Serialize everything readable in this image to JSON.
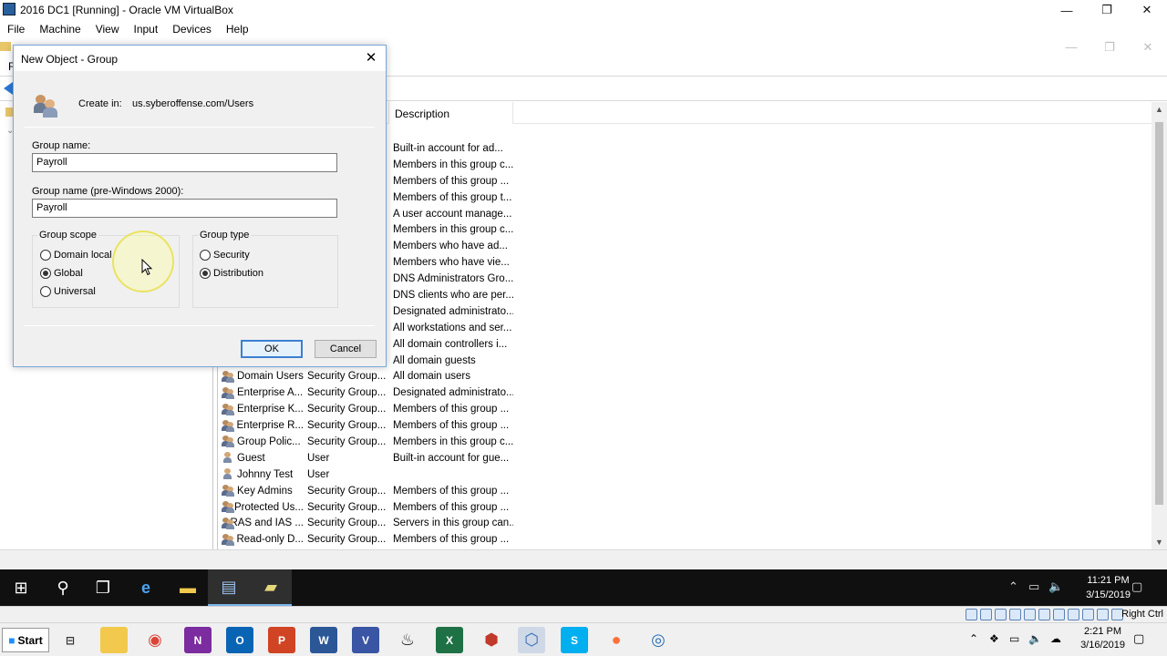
{
  "vbox": {
    "title": "2016 DC1 [Running] - Oracle VM VirtualBox",
    "menu": [
      "File",
      "Machine",
      "View",
      "Input",
      "Devices",
      "Help"
    ],
    "controls": {
      "minimize": "—",
      "restore": "❐",
      "close": "✕"
    },
    "status": {
      "hostkey": "Right Ctrl"
    }
  },
  "mmc": {
    "menu_partial": "F",
    "list_header": {
      "description": "Description"
    },
    "rows": [
      {
        "name": "",
        "type": "",
        "desc": "Built-in account for ad...",
        "icon": "group-icon"
      },
      {
        "name": "",
        "type": "",
        "desc": "Members in this group c...",
        "icon": "group-icon"
      },
      {
        "name": "",
        "type": "",
        "desc": "Members of this group ...",
        "icon": "group-icon"
      },
      {
        "name": "",
        "type": "",
        "desc": "Members of this group t...",
        "icon": "group-icon"
      },
      {
        "name": "",
        "type": "",
        "desc": "A user account manage...",
        "icon": "group-icon"
      },
      {
        "name": "",
        "type": "",
        "desc": "Members in this group c...",
        "icon": "group-icon"
      },
      {
        "name": "",
        "type": "",
        "desc": "Members who have ad...",
        "icon": "group-icon"
      },
      {
        "name": "",
        "type": "",
        "desc": "Members who have vie...",
        "icon": "group-icon"
      },
      {
        "name": "",
        "type": "",
        "desc": "DNS Administrators Gro...",
        "icon": "group-icon"
      },
      {
        "name": "",
        "type": "",
        "desc": "DNS clients who are per...",
        "icon": "group-icon"
      },
      {
        "name": "",
        "type": "",
        "desc": "Designated administrato...",
        "icon": "group-icon"
      },
      {
        "name": "",
        "type": "",
        "desc": "All workstations and ser...",
        "icon": "group-icon"
      },
      {
        "name": "",
        "type": "",
        "desc": "All domain controllers i...",
        "icon": "group-icon"
      },
      {
        "name": "",
        "type": "",
        "desc": "All domain guests",
        "icon": "group-icon"
      },
      {
        "name": "Domain Users",
        "type": "Security Group...",
        "desc": "All domain users",
        "icon": "group-icon"
      },
      {
        "name": "Enterprise A...",
        "type": "Security Group...",
        "desc": "Designated administrato...",
        "icon": "group-icon"
      },
      {
        "name": "Enterprise K...",
        "type": "Security Group...",
        "desc": "Members of this group ...",
        "icon": "group-icon"
      },
      {
        "name": "Enterprise R...",
        "type": "Security Group...",
        "desc": "Members of this group ...",
        "icon": "group-icon"
      },
      {
        "name": "Group Polic...",
        "type": "Security Group...",
        "desc": "Members in this group c...",
        "icon": "group-icon"
      },
      {
        "name": "Guest",
        "type": "User",
        "desc": "Built-in account for gue...",
        "icon": "user-icon"
      },
      {
        "name": "Johnny Test",
        "type": "User",
        "desc": "",
        "icon": "user-icon"
      },
      {
        "name": "Key Admins",
        "type": "Security Group...",
        "desc": "Members of this group ...",
        "icon": "group-icon"
      },
      {
        "name": "Protected Us...",
        "type": "Security Group...",
        "desc": "Members of this group ...",
        "icon": "group-icon"
      },
      {
        "name": "RAS and IAS ...",
        "type": "Security Group...",
        "desc": "Servers in this group can...",
        "icon": "group-icon"
      },
      {
        "name": "Read-only D...",
        "type": "Security Group...",
        "desc": "Members of this group ...",
        "icon": "group-icon"
      }
    ]
  },
  "dialog": {
    "title": "New Object - Group",
    "create_in_label": "Create in:",
    "create_in_path": "us.syberoffense.com/Users",
    "group_name_label": "Group name:",
    "group_name_value": "Payroll",
    "group_name_pre2000_label": "Group name (pre-Windows 2000):",
    "group_name_pre2000_value": "Payroll",
    "scope_title": "Group scope",
    "scope_options": [
      {
        "label": "Domain local",
        "selected": false
      },
      {
        "label": "Global",
        "selected": true
      },
      {
        "label": "Universal",
        "selected": false
      }
    ],
    "type_title": "Group type",
    "type_options": [
      {
        "label": "Security",
        "selected": false
      },
      {
        "label": "Distribution",
        "selected": true
      }
    ],
    "ok": "OK",
    "cancel": "Cancel"
  },
  "guest_taskbar": {
    "time": "11:21 PM",
    "date": "3/15/2019"
  },
  "host_taskbar": {
    "start": "Start",
    "time": "2:21 PM",
    "date": "3/16/2019"
  },
  "colors": {
    "accent": "#3c7fd1",
    "taskbar_dark": "#101010",
    "dialog_bg": "#f0f0f0"
  }
}
